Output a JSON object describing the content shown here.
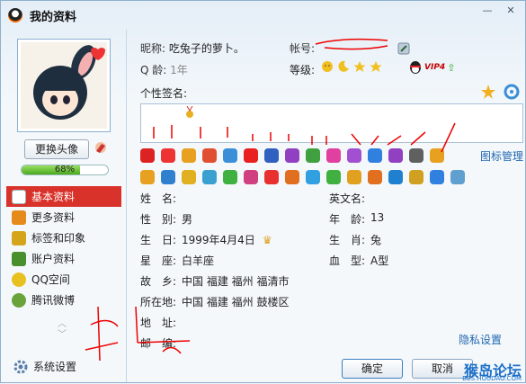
{
  "window": {
    "title": "我的资料",
    "minimize": "—",
    "close": "✕"
  },
  "left": {
    "change_avatar": "更换头像",
    "progress_text": "68%",
    "progress": 0.68,
    "nav": [
      {
        "label": "基本资料",
        "color": "#3a7bd5"
      },
      {
        "label": "更多资料",
        "color": "#e58b1b"
      },
      {
        "label": "标签和印象",
        "color": "#d4a51b"
      },
      {
        "label": "账户资料",
        "color": "#4a8f2e"
      },
      {
        "label": "QQ空间",
        "color": "#e8c020"
      },
      {
        "label": "腾讯微博",
        "color": "#6aa33a"
      }
    ],
    "settings": "系统设置"
  },
  "profile": {
    "nickname_label": "昵称:",
    "nickname": "吃兔子的萝卜。",
    "account_label": "帐号:",
    "account": "",
    "qage_label": "Q 龄:",
    "qage": "1年",
    "level_label": "等级:",
    "vip": "VIP4",
    "signature_label": "个性签名:",
    "icon_manage": "图标管理"
  },
  "info": {
    "rows": [
      {
        "k": "姓　名:",
        "v": "",
        "k2": "英文名:",
        "v2": ""
      },
      {
        "k": "性　别:",
        "v": "男",
        "k2": "年　龄:",
        "v2": "13"
      },
      {
        "k": "生　日:",
        "v": "1999年4月4日",
        "k2": "生　肖:",
        "v2": "兔"
      },
      {
        "k": "星　座:",
        "v": "白羊座",
        "k2": "血　型:",
        "v2": "A型"
      },
      {
        "k": "故　乡:",
        "v": "中国  福建  福州  福清市",
        "k2": "",
        "v2": ""
      },
      {
        "k": "所在地:",
        "v": "中国  福建  福州  鼓楼区",
        "k2": "",
        "v2": ""
      },
      {
        "k": "地　址:",
        "v": "",
        "k2": "",
        "v2": ""
      },
      {
        "k": "邮　编:",
        "v": "",
        "k2": "",
        "v2": ""
      }
    ],
    "privacy": "隐私设置"
  },
  "buttons": {
    "ok": "确定",
    "cancel": "取消"
  },
  "watermark": {
    "text": "猴岛论坛",
    "url": "BBS.HOUDAO.COM"
  },
  "badge_row_1": [
    "#d22",
    "#e33",
    "#e8a020",
    "#e05030",
    "#3a8fd8",
    "#e82020",
    "#3060c0",
    "#9040c0",
    "#40a040",
    "#e040a0",
    "#a050d0",
    "#3080e0",
    "#9040c0",
    "#606060",
    "#e8a020"
  ],
  "badge_row_2": [
    "#e8a020",
    "#3080d0",
    "#e0b020",
    "#3aa0d0",
    "#40b040",
    "#d04080",
    "#e83030",
    "#e07020",
    "#30a0e0",
    "#40b040",
    "#e0a020",
    "#e07020",
    "#2080d0",
    "#d0a020",
    "#3080e0",
    "#60a0d0"
  ]
}
